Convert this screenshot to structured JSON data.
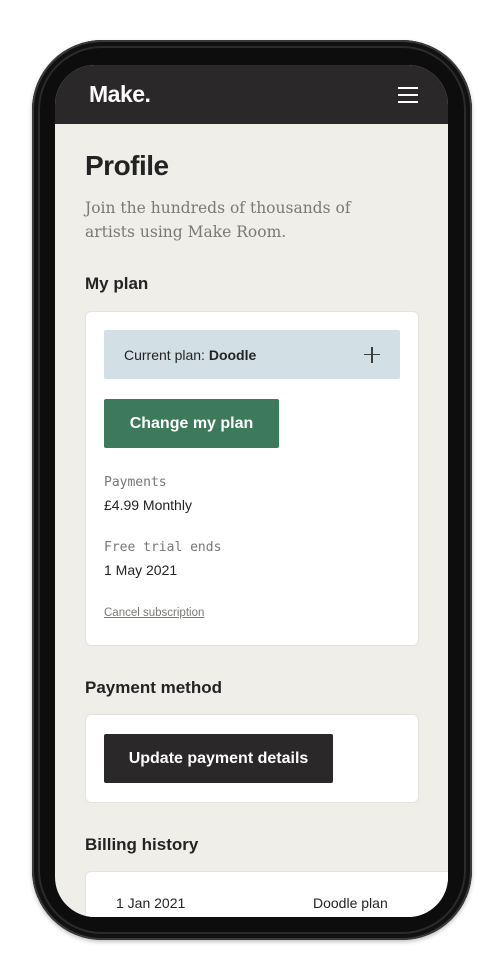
{
  "app": {
    "logo": "Make."
  },
  "page": {
    "title": "Profile",
    "intro": "Join the hundreds of thousands of artists using Make Room."
  },
  "my_plan": {
    "heading": "My plan",
    "current_plan_label": "Current plan:",
    "current_plan_name": "Doodle",
    "change_button": "Change my plan",
    "payments_label": "Payments",
    "payments_value": "£4.99 Monthly",
    "trial_label": "Free trial ends",
    "trial_value": "1 May 2021",
    "cancel_link": "Cancel subscription"
  },
  "payment_method": {
    "heading": "Payment method",
    "update_button": "Update payment details"
  },
  "billing_history": {
    "heading": "Billing history",
    "rows": [
      {
        "date": "1 Jan 2021",
        "plan": "Doodle plan"
      }
    ]
  },
  "colors": {
    "nav_bg": "#2a2828",
    "page_bg": "#efeee9",
    "plan_bar_bg": "#d2e0e6",
    "primary_green": "#3d7a5b"
  }
}
